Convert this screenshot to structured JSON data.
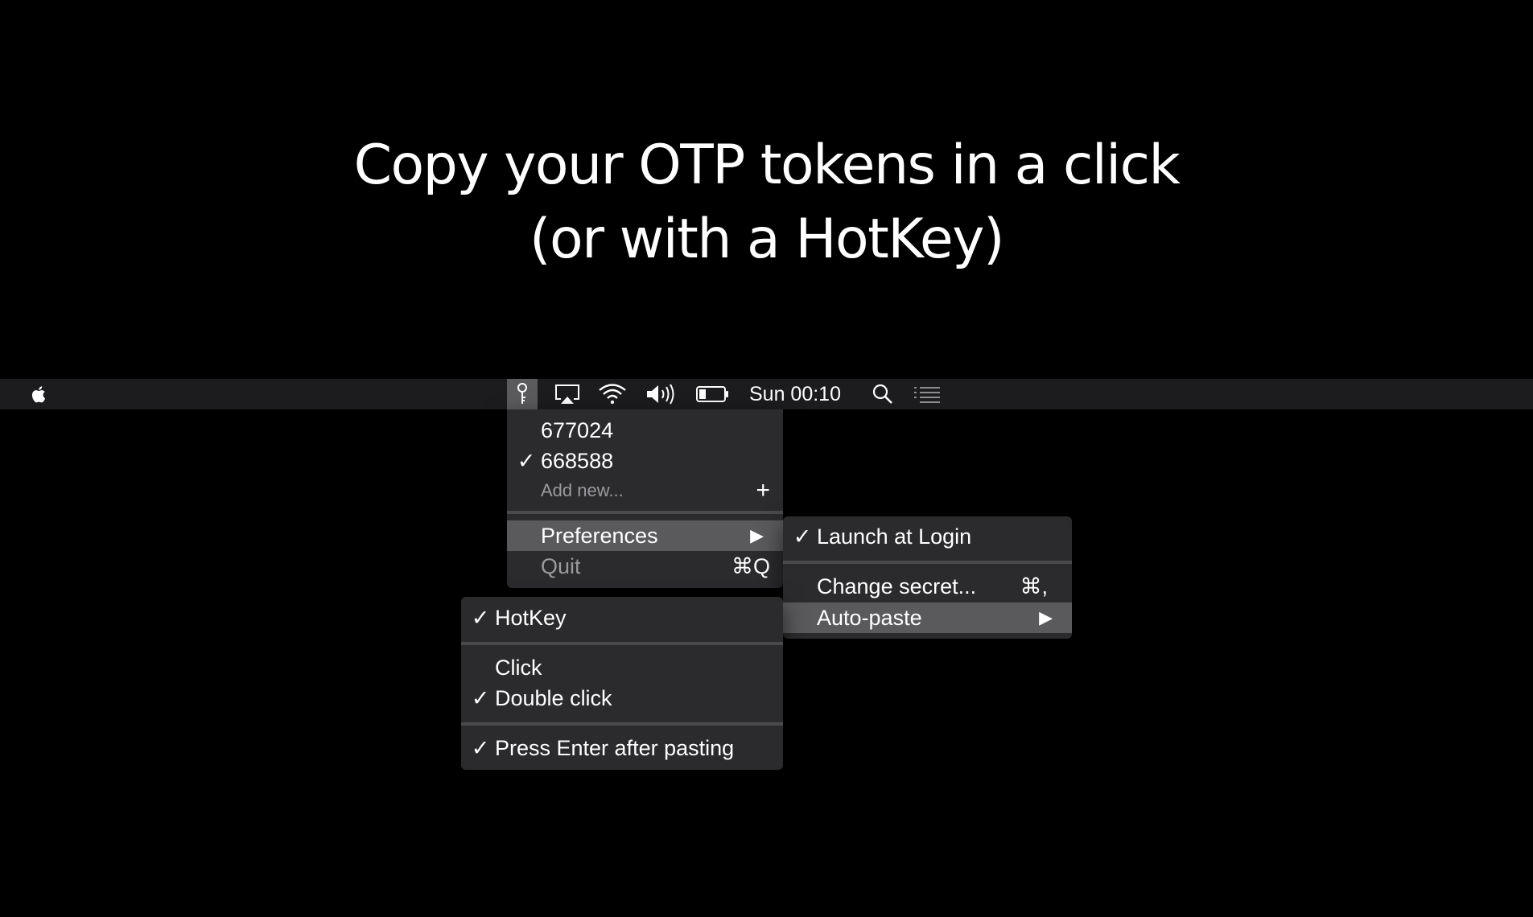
{
  "headline": {
    "line1": "Copy your OTP tokens in a click",
    "line2": "(or with a HotKey)"
  },
  "menubar": {
    "apple_icon": "apple-logo-icon",
    "status_icons": [
      "key-icon",
      "airplay-icon",
      "wifi-icon",
      "volume-icon",
      "battery-icon",
      "search-icon",
      "list-icon"
    ],
    "clock": "Sun 00:10"
  },
  "main_menu": {
    "tokens": [
      {
        "code": "677024",
        "checked": false
      },
      {
        "code": "668588",
        "checked": true
      }
    ],
    "add_new_label": "Add new...",
    "add_new_shortcut": "+",
    "preferences_label": "Preferences",
    "quit_label": "Quit",
    "quit_shortcut": "⌘Q"
  },
  "preferences_menu": {
    "launch_at_login_label": "Launch at Login",
    "launch_at_login_checked": true,
    "change_secret_label": "Change secret...",
    "change_secret_shortcut": "⌘,",
    "auto_paste_label": "Auto-paste"
  },
  "auto_paste_menu": {
    "hotkey_label": "HotKey",
    "hotkey_checked": true,
    "click_label": "Click",
    "click_checked": false,
    "double_click_label": "Double click",
    "double_click_checked": true,
    "press_enter_label": "Press Enter after pasting",
    "press_enter_checked": true
  },
  "glyphs": {
    "check": "✓",
    "submenu_arrow": "▶"
  },
  "colors": {
    "background": "#000000",
    "menubar": "#1c1c1e",
    "menu": "#2b2b2d",
    "highlight": "#5a5a5d"
  }
}
